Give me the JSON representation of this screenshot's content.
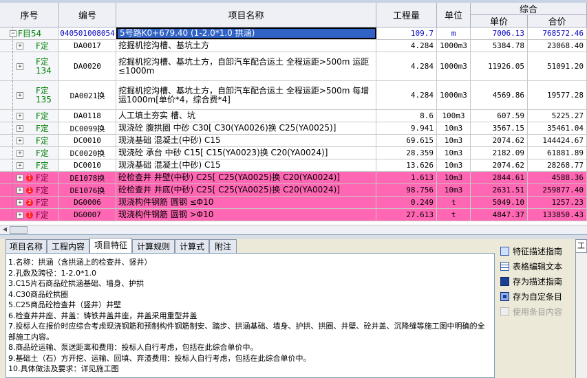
{
  "grid": {
    "headers": {
      "seq": "序号",
      "code": "编号",
      "name": "项目名称",
      "qty": "工程量",
      "unit": "单位",
      "group": "综合",
      "unit_price": "单价",
      "total_price": "合价"
    },
    "rows": [
      {
        "seq": "F目54",
        "code": "040501008054",
        "name": "5号路K0+679.40 (1-2.0*1.0 拱涵)",
        "qty": "109.7",
        "unit": "m",
        "unit_price": "7006.13",
        "total_price": "768572.46",
        "style": "first",
        "lines": 1
      },
      {
        "seq": "F定",
        "code": "DA0017",
        "name": "挖掘机挖沟槽、基坑土方",
        "qty": "4.284",
        "unit": "1000m3",
        "unit_price": "5384.78",
        "total_price": "23068.40",
        "style": "normal",
        "lines": 1
      },
      {
        "seq": "F定\n134",
        "code": "DA0020",
        "name": "挖掘机挖沟槽、基坑土方，自卸汽车配合运土 全程运距>500m 运距≤1000m",
        "qty": "4.284",
        "unit": "1000m3",
        "unit_price": "11926.05",
        "total_price": "51091.20",
        "style": "normal",
        "lines": 3
      },
      {
        "seq": "F定\n135",
        "code": "DA0021换",
        "name": "挖掘机挖沟槽、基坑土方，自卸汽车配合运土 全程运距>500m 每增运1000m[单价*4，综合费*4]",
        "qty": "4.284",
        "unit": "1000m3",
        "unit_price": "4569.86",
        "total_price": "19577.28",
        "style": "normal",
        "lines": 3
      },
      {
        "seq": "F定",
        "code": "DA0118",
        "name": "人工填土夯实 槽、坑",
        "qty": "8.6",
        "unit": "100m3",
        "unit_price": "607.59",
        "total_price": "5225.27",
        "style": "normal",
        "lines": 1
      },
      {
        "seq": "F定",
        "code": "DC0099换",
        "name": "现浇砼 腹拱圈 中砂 C30[ C30(YA0026)换 C25(YA0025)]",
        "qty": "9.941",
        "unit": "10m3",
        "unit_price": "3567.15",
        "total_price": "35461.04",
        "style": "normal",
        "lines": 1
      },
      {
        "seq": "F定",
        "code": "DC0010",
        "name": "现浇基础 混凝土(中砂) C15",
        "qty": "69.615",
        "unit": "10m3",
        "unit_price": "2074.62",
        "total_price": "144424.67",
        "style": "normal",
        "lines": 1
      },
      {
        "seq": "F定",
        "code": "DC0020换",
        "name": "现浇砼 承台 中砂 C15[ C15(YA0023)换 C20(YA0024)]",
        "qty": "28.359",
        "unit": "10m3",
        "unit_price": "2182.09",
        "total_price": "61881.89",
        "style": "normal",
        "lines": 1
      },
      {
        "seq": "F定",
        "code": "DC0010",
        "name": "现浇基础 混凝土(中砂) C15",
        "qty": "13.626",
        "unit": "10m3",
        "unit_price": "2074.62",
        "total_price": "28268.77",
        "style": "normal",
        "lines": 1
      },
      {
        "seq": "F定",
        "code": "DE1078换",
        "name": "砼检查井 井壁(中砂) C25[ C25(YA0025)换 C20(YA0024)]",
        "qty": "1.613",
        "unit": "10m3",
        "unit_price": "2844.61",
        "total_price": "4588.36",
        "style": "pink",
        "badge": "1",
        "lines": 1
      },
      {
        "seq": "F定",
        "code": "DE1076换",
        "name": "砼检查井 井底(中砂) C25[ C25(YA0025)换 C20(YA0024)]",
        "qty": "98.756",
        "unit": "10m3",
        "unit_price": "2631.51",
        "total_price": "259877.40",
        "style": "pink",
        "badge": "1",
        "lines": 1
      },
      {
        "seq": "F定",
        "code": "DG0006",
        "name": "现浇构件钢筋 圆钢 ≤Φ10",
        "qty": "0.249",
        "unit": "t",
        "unit_price": "5049.10",
        "total_price": "1257.23",
        "style": "pink",
        "badge": "2",
        "lines": 1
      },
      {
        "seq": "F定",
        "code": "DG0007",
        "name": "现浇构件钢筋 圆钢 >Φ10",
        "qty": "27.613",
        "unit": "t",
        "unit_price": "4847.37",
        "total_price": "133850.43",
        "style": "pink",
        "badge": "1",
        "lines": 1
      }
    ]
  },
  "tabs": [
    "项目名称",
    "工程内容",
    "项目特征",
    "计算规则",
    "计算式",
    "附注"
  ],
  "active_tab": "项目特征",
  "description_lines": [
    "1.名称：拱涵（含拱涵上的检查井、竖井）",
    "2.孔数及跨径：1-2.0*1.0",
    "3.C15片石商品砼拱涵基础、墙身、护拱",
    "4.C30商品砼拱圈",
    "5.C25商品砼检查井（竖井）井壁",
    "6.检查井井座、井盖：铸铁井盖井座，井盖采用重型井盖",
    "7.投标人在报价时应综合考虑现浇钢筋和预制构件钢筋制安、踏步、拱涵基础、墙身、护拱、拱圈、井壁、砼井盖、沉降缝等施工图中明确的全部施工内容。",
    "8.商品砼运输、泵送距离和费用：投标人自行考虑，包括在此综合单价中。",
    "9.基础土（石）方开挖、运输、回填、弃渣费用：投标人自行考虑，包括在此综合单价中。",
    "10.具体做法及要求：详见施工图"
  ],
  "side_buttons": [
    {
      "label": "特征描述指南",
      "icon": "guide-icon",
      "enabled": true
    },
    {
      "label": "表格编辑文本",
      "icon": "table-icon",
      "enabled": true
    },
    {
      "label": "存为描述指南",
      "icon": "save-disk-icon",
      "enabled": true
    },
    {
      "label": "存为自定条目",
      "icon": "save-entry-icon",
      "enabled": true
    },
    {
      "label": "使用条目内容",
      "icon": "use-entry-icon",
      "enabled": false
    }
  ],
  "right_panel_tab": "工",
  "colors": {
    "pink_row": "#ff66b3",
    "selection": "#3163c6",
    "header_bg": "#eef0f5",
    "seq_text": "#008000"
  }
}
